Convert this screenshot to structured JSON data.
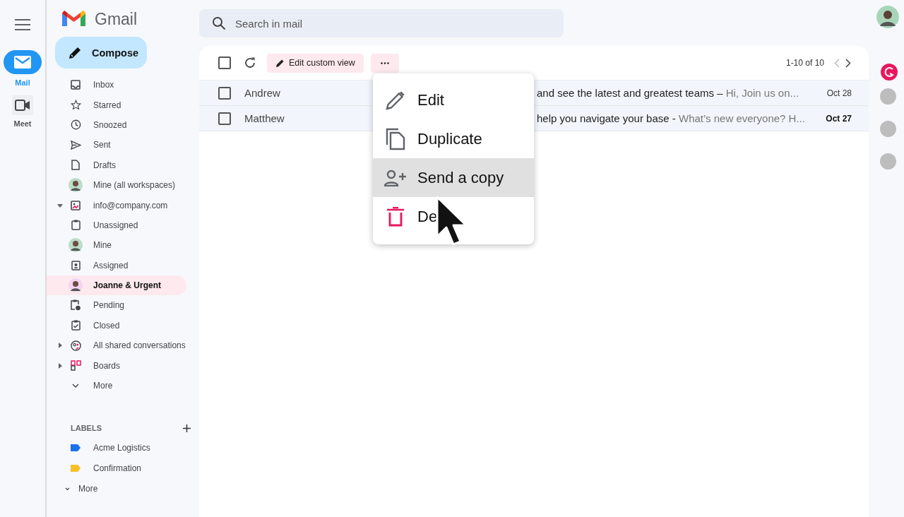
{
  "rail": {
    "items": [
      {
        "kind": "mail",
        "label": "Mail",
        "selected": true
      },
      {
        "kind": "meet",
        "label": "Meet",
        "selected": false
      }
    ]
  },
  "app": {
    "name": "Gmail"
  },
  "compose": {
    "label": "Compose"
  },
  "search": {
    "placeholder": "Search in mail"
  },
  "sidebar": {
    "items": [
      {
        "kind": "inbox",
        "label": "Inbox",
        "selected": false
      },
      {
        "kind": "star",
        "label": "Starred",
        "selected": false
      },
      {
        "kind": "clock",
        "label": "Snoozed",
        "selected": false
      },
      {
        "kind": "send",
        "label": "Sent",
        "selected": false
      },
      {
        "kind": "draft",
        "label": "Drafts",
        "selected": false
      },
      {
        "kind": "avatar",
        "label": "Mine (all workspaces)",
        "selected": false
      },
      {
        "kind": "shared",
        "label": "info@company.com",
        "selected": false,
        "expanded": true
      },
      {
        "kind": "clipboard",
        "label": "Unassigned",
        "selected": false
      },
      {
        "kind": "avatar",
        "label": "Mine",
        "selected": false
      },
      {
        "kind": "badge",
        "label": "Assigned",
        "selected": false
      },
      {
        "kind": "avatar",
        "label": "Joanne & Urgent",
        "selected": true
      },
      {
        "kind": "pending",
        "label": "Pending",
        "selected": false
      },
      {
        "kind": "closed",
        "label": "Closed",
        "selected": false
      },
      {
        "kind": "people",
        "label": "All shared conversations",
        "selected": false,
        "expanded": false
      },
      {
        "kind": "boards",
        "label": "Boards",
        "selected": false,
        "expanded": false
      },
      {
        "kind": "more",
        "label": "More",
        "selected": false
      }
    ]
  },
  "labels": {
    "heading": "LABELS",
    "items": [
      {
        "label": "Acme Logistics",
        "color": "#1a73e8"
      },
      {
        "label": "Confirmation",
        "color": "#f6bf26"
      }
    ],
    "more": "More"
  },
  "toolbar": {
    "select_all_checked": false,
    "edit_view": "Edit custom view",
    "pagination": "1-10 of 10"
  },
  "rows": [
    {
      "sender": "Andrew",
      "subject": "and see the latest and greatest teams –",
      "snippet": "Hi, Join us on...",
      "date": "Oct 28",
      "unread": false,
      "checked": false
    },
    {
      "sender": "Matthew",
      "subject": "help you navigate your base -",
      "snippet": "What’s new everyone? H...",
      "date": "Oct 27",
      "unread": true,
      "checked": false
    }
  ],
  "menu": {
    "items": [
      {
        "kind": "edit",
        "label": "Edit",
        "selected": false
      },
      {
        "kind": "duplicate",
        "label": "Duplicate",
        "selected": false
      },
      {
        "kind": "send_copy",
        "label": "Send a copy",
        "selected": true
      },
      {
        "kind": "delete",
        "label": "De",
        "selected": false
      }
    ]
  }
}
